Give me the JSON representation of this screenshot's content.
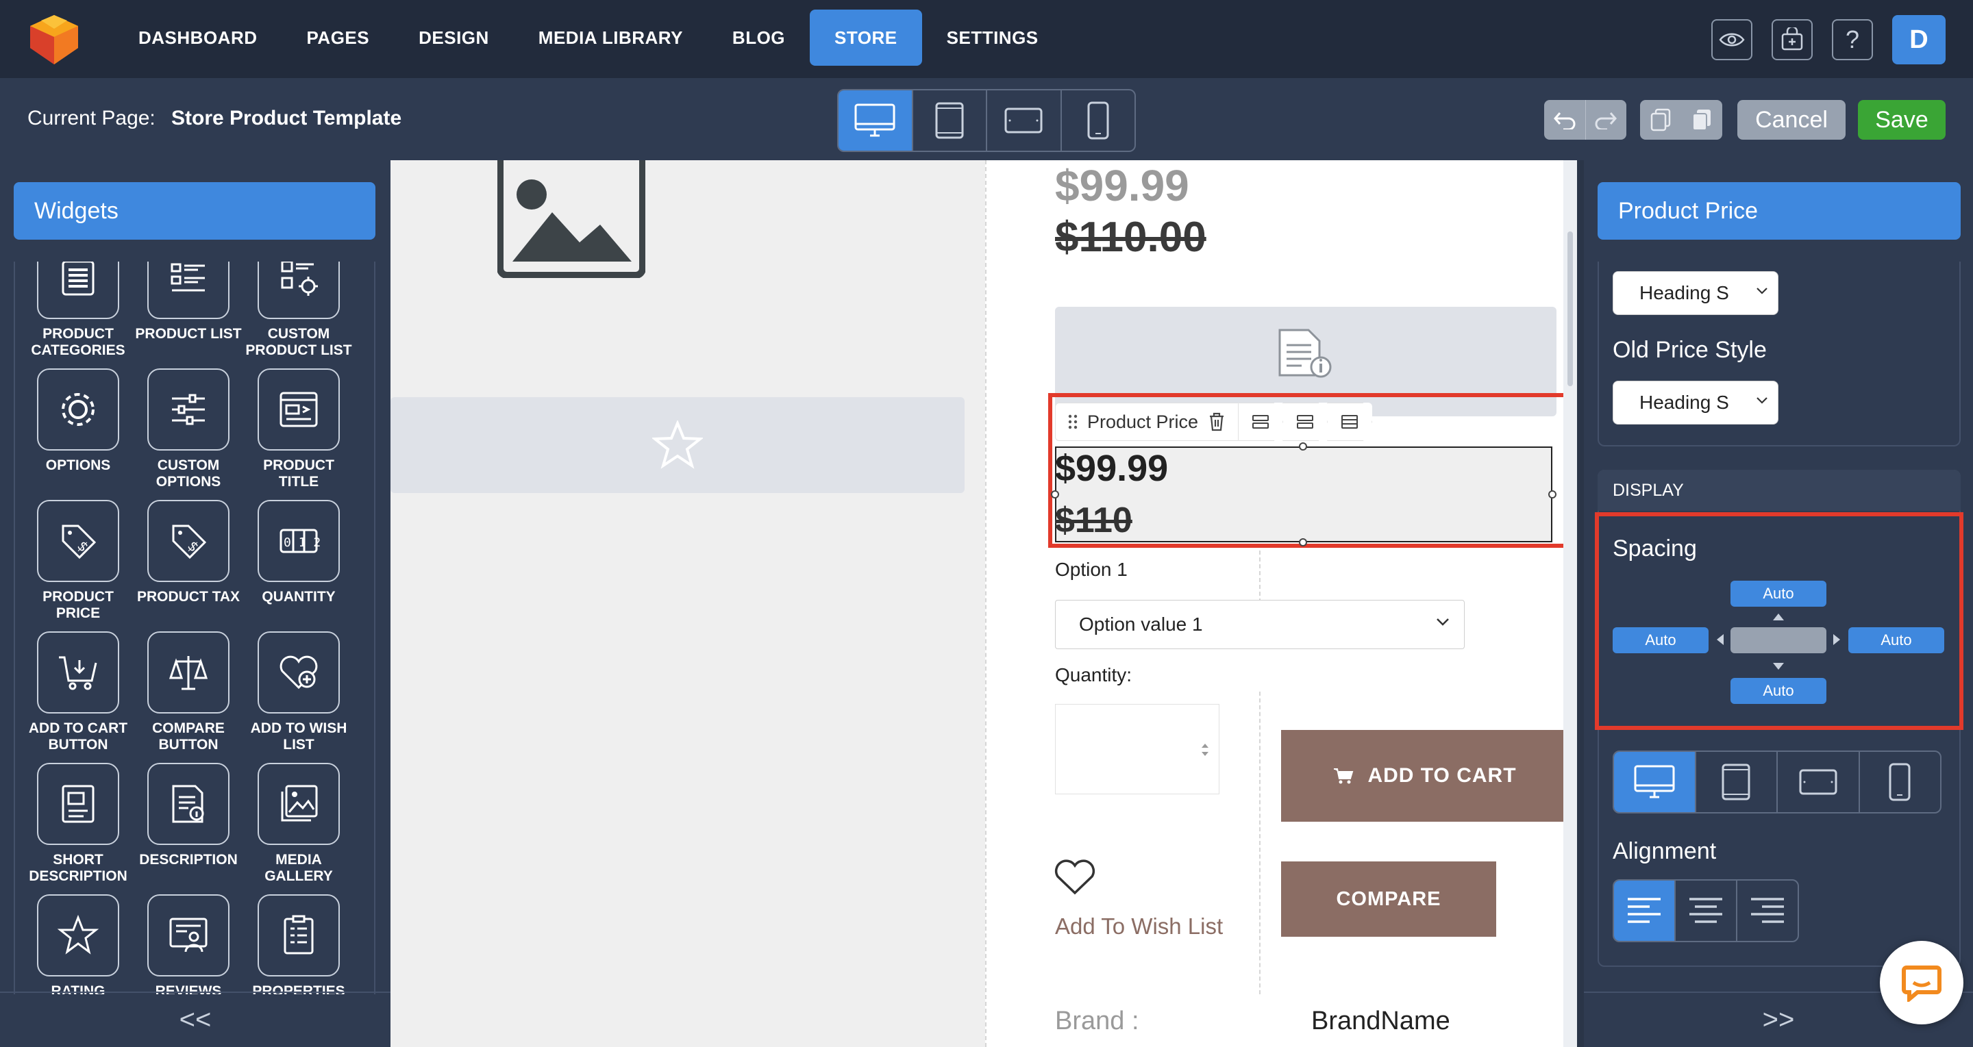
{
  "nav": {
    "items": [
      "DASHBOARD",
      "PAGES",
      "DESIGN",
      "MEDIA LIBRARY",
      "BLOG",
      "STORE",
      "SETTINGS"
    ],
    "active": "STORE",
    "avatar": "D",
    "help": "?"
  },
  "subbar": {
    "current_label": "Current Page:",
    "current_value": "Store Product Template",
    "cancel": "Cancel",
    "save": "Save"
  },
  "left": {
    "title": "Widgets",
    "widgets": [
      {
        "label": "PRODUCT CATEGORIES",
        "icon": "list-icon"
      },
      {
        "label": "PRODUCT LIST",
        "icon": "product-list-icon"
      },
      {
        "label": "CUSTOM PRODUCT LIST",
        "icon": "custom-list-icon"
      },
      {
        "label": "OPTIONS",
        "icon": "gear-icon"
      },
      {
        "label": "CUSTOM OPTIONS",
        "icon": "sliders-icon"
      },
      {
        "label": "PRODUCT TITLE",
        "icon": "title-icon"
      },
      {
        "label": "PRODUCT PRICE",
        "icon": "price-tag-icon"
      },
      {
        "label": "PRODUCT TAX",
        "icon": "tax-tag-icon"
      },
      {
        "label": "QUANTITY",
        "icon": "counter-icon"
      },
      {
        "label": "ADD TO CART BUTTON",
        "icon": "cart-icon"
      },
      {
        "label": "COMPARE BUTTON",
        "icon": "scale-icon"
      },
      {
        "label": "ADD TO WISH LIST",
        "icon": "heart-plus-icon"
      },
      {
        "label": "SHORT DESCRIPTION",
        "icon": "short-desc-icon"
      },
      {
        "label": "DESCRIPTION",
        "icon": "description-icon"
      },
      {
        "label": "MEDIA GALLERY",
        "icon": "gallery-icon"
      },
      {
        "label": "RATING",
        "icon": "star-icon"
      },
      {
        "label": "REVIEWS",
        "icon": "reviews-icon"
      },
      {
        "label": "PROPERTIES",
        "icon": "properties-icon"
      }
    ],
    "collapse": "<<"
  },
  "canvas": {
    "price_top": "$99.99",
    "old_price_top": "$110.00",
    "toolbar_label": "Product Price",
    "price": "$99.99",
    "old_price": "$110",
    "option_label": "Option 1",
    "option_value": "Option value 1",
    "quantity_label": "Quantity:",
    "add_to_cart": "ADD TO CART",
    "wish_list": "Add To Wish List",
    "compare": "COMPARE",
    "brand_label": "Brand :",
    "brand_value": "BrandName"
  },
  "right": {
    "title": "Product Price",
    "price_style": "Heading S",
    "old_price_style_label": "Old Price Style",
    "old_price_style": "Heading S",
    "display_label": "DISPLAY",
    "spacing_label": "Spacing",
    "spacing": {
      "top": "Auto",
      "left": "Auto",
      "right": "Auto",
      "bottom": "Auto"
    },
    "alignment_label": "Alignment",
    "alignment": "left",
    "expand": ">>"
  },
  "colors": {
    "accent": "#3f88de",
    "save": "#3aa535",
    "highlight": "#e23a2b",
    "button_brown": "#8b6d64"
  }
}
